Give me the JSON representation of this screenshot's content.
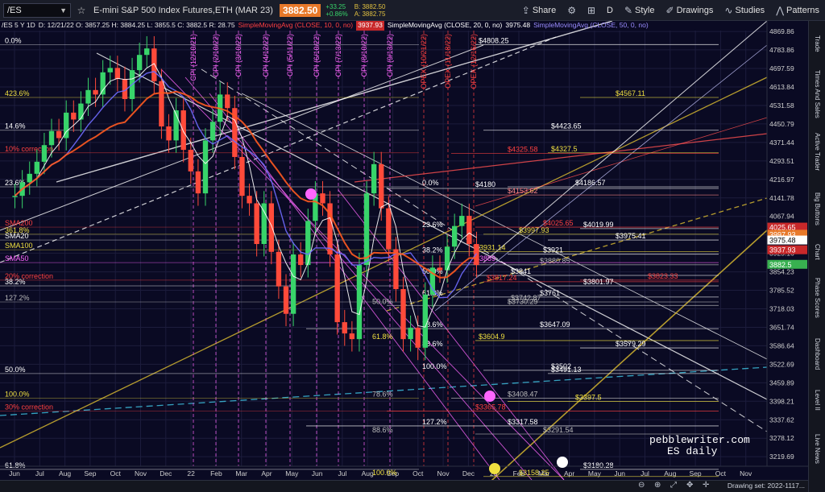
{
  "toolbar": {
    "symbol": "/ES",
    "title": "E-mini S&P 500 Index Futures,ETH (MAR 23)",
    "last_price": "3882.50",
    "change": "+33.25",
    "change_pct": "+0.86%",
    "bid": "B: 3882.50",
    "ask": "A: 3882.75",
    "buttons": {
      "share": "Share",
      "period": "D",
      "style": "Style",
      "drawings": "Drawings",
      "studies": "Studies",
      "patterns": "Patterns"
    }
  },
  "legend": {
    "header": "/ES 5 Y 1D",
    "ohlc": "D: 12/21/22  O: 3857.25  H: 3884.25  L: 3855.5  C: 3882.5  R: 28.75",
    "sma1_label": "SimpleMovingAvg (CLOSE, 10, 0, no)",
    "sma1_value": "3937.93",
    "sma2_label": "SimpleMovingAvg (CLOSE, 20, 0, no)",
    "sma2_value": "3975.48",
    "sma3_label": "SimpleMovingAvg (CLOSE, 50, 0, no)"
  },
  "watermark": {
    "line1": "pebblewriter.com",
    "line2": "ES daily"
  },
  "side_tabs": [
    "Trade",
    "Times And Sales",
    "Active Trader",
    "Big Buttons",
    "Chart",
    "Phase Scores",
    "Dashboard",
    "Level II",
    "Live News"
  ],
  "bottom": {
    "drawing_set": "Drawing set: 2022-1117..."
  },
  "chart_data": {
    "type": "candlestick",
    "title": "E-mini S&P 500 Index Futures,ETH (MAR 23)",
    "y_axis": {
      "ticks": [
        "4869.86",
        "4783.86",
        "4697.59",
        "4613.84",
        "4531.58",
        "4450.79",
        "4371.44",
        "4293.51",
        "4216.97",
        "4141.78",
        "4067.94",
        "3995.41",
        "3925.16",
        "3854.23",
        "3785.52",
        "3718.03",
        "3651.74",
        "3586.64",
        "3522.69",
        "3459.89",
        "3398.21",
        "3337.62",
        "3278.12",
        "3219.69"
      ],
      "ylim": [
        3190,
        4920
      ],
      "scale": "log"
    },
    "x_axis": {
      "ticks": [
        "Jun",
        "Jul",
        "Aug",
        "Sep",
        "Oct",
        "Nov",
        "Dec",
        "22",
        "Feb",
        "Mar",
        "Apr",
        "May",
        "Jun",
        "Jul",
        "Aug",
        "Sep",
        "Oct",
        "Nov",
        "Dec",
        "23",
        "Feb",
        "Mar",
        "Apr",
        "May",
        "Jun",
        "Jul",
        "Aug",
        "Sep",
        "Oct",
        "Nov"
      ]
    },
    "price_labels": [
      {
        "label": "$4808.25",
        "value": 4808.25,
        "color": "#ffffff"
      },
      {
        "label": "$4567.11",
        "value": 4567.11,
        "color": "#f0e040"
      },
      {
        "label": "$4423.65",
        "value": 4423.65,
        "color": "#ffffff"
      },
      {
        "label": "$4327.5",
        "value": 4327.5,
        "color": "#f0e040"
      },
      {
        "label": "$4325.58",
        "value": 4325.58,
        "color": "#ff4040"
      },
      {
        "label": "$4186.57",
        "value": 4186.57,
        "color": "#ffffff"
      },
      {
        "label": "$4180",
        "value": 4180,
        "color": "#ffffff"
      },
      {
        "label": "$4153.62",
        "value": 4153.62,
        "color": "#ff8888"
      },
      {
        "label": "$4025.65",
        "value": 4025.65,
        "color": "#ff4040"
      },
      {
        "label": "$4019.99",
        "value": 4019.99,
        "color": "#ffffff"
      },
      {
        "label": "$3997.93",
        "value": 3997.93,
        "color": "#f0e040"
      },
      {
        "label": "$3975.41",
        "value": 3975.41,
        "color": "#ffffff"
      },
      {
        "label": "$3931.14",
        "value": 3931.14,
        "color": "#f0e040"
      },
      {
        "label": "$3921",
        "value": 3921,
        "color": "#ffffff"
      },
      {
        "label": "$3880.85",
        "value": 3880.85,
        "color": "#bbbbbb"
      },
      {
        "label": "$3889",
        "value": 3889,
        "color": "#ff66ff"
      },
      {
        "label": "$3841",
        "value": 3841,
        "color": "#ffffff"
      },
      {
        "label": "$3823.33",
        "value": 3823.33,
        "color": "#ff4040"
      },
      {
        "label": "$3817.24",
        "value": 3817.24,
        "color": "#ff4040"
      },
      {
        "label": "$3801.97",
        "value": 3801.97,
        "color": "#ffffff"
      },
      {
        "label": "$3761",
        "value": 3761,
        "color": "#ffffff"
      },
      {
        "label": "$3742.87",
        "value": 3742.87,
        "color": "#bbbbbb"
      },
      {
        "label": "$3730.29",
        "value": 3730.29,
        "color": "#bbbbbb"
      },
      {
        "label": "$3647.09",
        "value": 3647.09,
        "color": "#ffffff"
      },
      {
        "label": "$3604.9",
        "value": 3604.9,
        "color": "#f0e040"
      },
      {
        "label": "$3579.29",
        "value": 3579.29,
        "color": "#ffffff"
      },
      {
        "label": "$3502",
        "value": 3502,
        "color": "#ffffff"
      },
      {
        "label": "$3491.13",
        "value": 3491.13,
        "color": "#ffffff"
      },
      {
        "label": "$3408.47",
        "value": 3408.47,
        "color": "#bbbbbb"
      },
      {
        "label": "$3397.5",
        "value": 3397.5,
        "color": "#f0e040"
      },
      {
        "label": "$3365.78",
        "value": 3365.78,
        "color": "#ff4040"
      },
      {
        "label": "$3317.58",
        "value": 3317.58,
        "color": "#ffffff"
      },
      {
        "label": "$3291.54",
        "value": 3291.54,
        "color": "#bbbbbb"
      },
      {
        "label": "$3180.28",
        "value": 3180.28,
        "color": "#ffffff"
      },
      {
        "label": "$3158.25",
        "value": 3158.25,
        "color": "#f0e040"
      }
    ],
    "axis_tags": [
      {
        "label": "4025.65",
        "value": 4025.65,
        "bg": "#c8282a",
        "fg": "#ffffff"
      },
      {
        "label": "3997.93",
        "value": 3997.93,
        "bg": "#e8792a",
        "fg": "#ffffff"
      },
      {
        "label": "3975.48",
        "value": 3975.48,
        "bg": "#ffffff",
        "fg": "#000000"
      },
      {
        "label": "3937.93",
        "value": 3937.93,
        "bg": "#c8282a",
        "fg": "#ffffff"
      },
      {
        "label": "3882.5",
        "value": 3882.5,
        "bg": "#38b050",
        "fg": "#ffffff"
      }
    ],
    "left_labels": [
      {
        "label": "0.0%",
        "value": 4808.25,
        "color": "#ffffff"
      },
      {
        "label": "423.6%",
        "value": 4567.11,
        "color": "#f0e040"
      },
      {
        "label": "14.6%",
        "value": 4423.65,
        "color": "#ffffff"
      },
      {
        "label": "10% correction",
        "value": 4327.5,
        "color": "#ff4040"
      },
      {
        "label": "23.6%",
        "value": 4186.57,
        "color": "#ffffff"
      },
      {
        "label": "SMA200",
        "value": 4025.65,
        "color": "#ff4040"
      },
      {
        "label": "361.8%",
        "value": 3997.93,
        "color": "#f0e040"
      },
      {
        "label": "SMA20",
        "value": 3975.48,
        "color": "#ffffff"
      },
      {
        "label": "SMA100",
        "value": 3937.93,
        "color": "#f0e040"
      },
      {
        "label": "SMA50",
        "value": 3889,
        "color": "#ff66ff"
      },
      {
        "label": "20% correction",
        "value": 3823.33,
        "color": "#ff4040"
      },
      {
        "label": "38.2%",
        "value": 3801.97,
        "color": "#ffffff"
      },
      {
        "label": "127.2%",
        "value": 3742.87,
        "color": "#bbbbbb"
      },
      {
        "label": "50.0%",
        "value": 3491.13,
        "color": "#ffffff"
      },
      {
        "label": "100.0%",
        "value": 3408.47,
        "color": "#f0e040"
      },
      {
        "label": "30% correction",
        "value": 3365.78,
        "color": "#ff4040"
      },
      {
        "label": "61.8%",
        "value": 3180.28,
        "color": "#ffffff"
      }
    ],
    "inner_labels": [
      {
        "label": "0.0%",
        "value": 4186.57,
        "color": "#ffffff"
      },
      {
        "label": "23.6%",
        "value": 4019.99,
        "color": "#ffffff"
      },
      {
        "label": "38.2%",
        "value": 3921,
        "color": "#ffffff"
      },
      {
        "label": "50.0%",
        "value": 3841,
        "color": "#ffffff"
      },
      {
        "label": "61.8%",
        "value": 3761,
        "color": "#ffffff"
      },
      {
        "label": "78.6%",
        "value": 3647.09,
        "color": "#ffffff"
      },
      {
        "label": "88.6%",
        "value": 3579.29,
        "color": "#ffffff"
      },
      {
        "label": "100.0%",
        "value": 3502,
        "color": "#ffffff"
      },
      {
        "label": "127.2%",
        "value": 3317.58,
        "color": "#ffffff"
      },
      {
        "label": "61.8%",
        "value": 3604.9,
        "color": "#f0e040"
      },
      {
        "label": "50.0%",
        "value": 3730.29,
        "color": "#bbbbbb"
      },
      {
        "label": "78.6%",
        "value": 3408.47,
        "color": "#bbbbbb"
      },
      {
        "label": "88.6%",
        "value": 3291.54,
        "color": "#bbbbbb"
      },
      {
        "label": "100.0%",
        "value": 3158.25,
        "color": "#f0e040"
      }
    ],
    "event_labels": [
      {
        "label": "CPI (12/10/21)",
        "color": "#ff66ff"
      },
      {
        "label": "CPI (2/10/22)",
        "color": "#ff66ff"
      },
      {
        "label": "CPI (3/10/22)",
        "color": "#ff66ff"
      },
      {
        "label": "CPI (4/12/22)",
        "color": "#ff66ff"
      },
      {
        "label": "CPI (5/11/22)",
        "color": "#ff66ff"
      },
      {
        "label": "CPI (6/10/22)",
        "color": "#ff66ff"
      },
      {
        "label": "CPI (7/13/22)",
        "color": "#ff66ff"
      },
      {
        "label": "CPI (8/10/22)",
        "color": "#ff66ff"
      },
      {
        "label": "CPI (9/13/22)",
        "color": "#ff66ff"
      },
      {
        "label": "OPEX (10/21/22)",
        "color": "#ff4040"
      },
      {
        "label": "OPEX (11/18/22)",
        "color": "#ff4040"
      },
      {
        "label": "OPEX (12/16/22)",
        "color": "#ff4040"
      }
    ],
    "closes": [
      4150,
      4205,
      4240,
      4290,
      4360,
      4420,
      4390,
      4500,
      4470,
      4540,
      4600,
      4580,
      4680,
      4700,
      4650,
      4560,
      4690,
      4760,
      4790,
      4640,
      4440,
      4380,
      4510,
      4340,
      4250,
      4160,
      4380,
      4460,
      4580,
      4520,
      4310,
      4150,
      4120,
      3960,
      4120,
      3930,
      3800,
      3700,
      3920,
      3880,
      4050,
      4160,
      4120,
      3920,
      3670,
      3630,
      3610,
      3880,
      4160,
      4280,
      4100,
      3940,
      3790,
      3610,
      3650,
      3580,
      3770,
      3870,
      3860,
      3950,
      4030,
      4070,
      3960,
      3880
    ]
  }
}
